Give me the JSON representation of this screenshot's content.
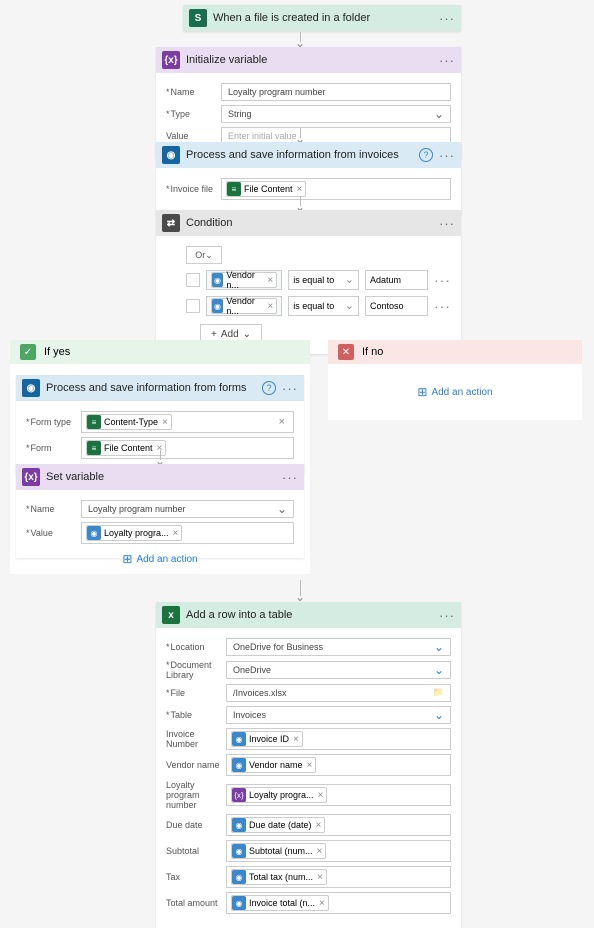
{
  "trigger": {
    "title": "When a file is created in a folder"
  },
  "init_var": {
    "title": "Initialize variable",
    "name_lbl": "Name",
    "name_val": "Loyalty program number",
    "type_lbl": "Type",
    "type_val": "String",
    "value_lbl": "Value",
    "value_ph": "Enter initial value"
  },
  "ai_invoices": {
    "title": "Process and save information from invoices",
    "file_lbl": "Invoice file",
    "file_token": "File Content"
  },
  "condition": {
    "title": "Condition",
    "group_op": "Or",
    "rows": [
      {
        "field": "Vendor n...",
        "op": "is equal to",
        "val": "Adatum"
      },
      {
        "field": "Vendor n...",
        "op": "is equal to",
        "val": "Contoso"
      }
    ],
    "add": "Add"
  },
  "branches": {
    "yes": "If yes",
    "no": "If no",
    "add_action": "Add an action"
  },
  "ai_forms": {
    "title": "Process and save information from  forms",
    "type_lbl": "Form type",
    "type_token": "Content-Type",
    "form_lbl": "Form",
    "form_token": "File Content"
  },
  "set_var": {
    "title": "Set variable",
    "name_lbl": "Name",
    "name_val": "Loyalty program number",
    "value_lbl": "Value",
    "value_token": "Loyalty progra..."
  },
  "excel": {
    "title": "Add a row into a table",
    "location_lbl": "Location",
    "location_val": "OneDrive for Business",
    "doclib_lbl": "Document Library",
    "doclib_val": "OneDrive",
    "file_lbl": "File",
    "file_val": "/Invoices.xlsx",
    "table_lbl": "Table",
    "table_val": "Invoices",
    "rows": [
      {
        "lbl": "Invoice Number",
        "token": "Invoice ID",
        "chip": "blue"
      },
      {
        "lbl": "Vendor name",
        "token": "Vendor name",
        "chip": "blue"
      },
      {
        "lbl": "Loyalty program number",
        "token": "Loyalty progra...",
        "chip": "purple"
      },
      {
        "lbl": "Due date",
        "token": "Due date (date)",
        "chip": "blue"
      },
      {
        "lbl": "Subtotal",
        "token": "Subtotal (num...",
        "chip": "blue"
      },
      {
        "lbl": "Tax",
        "token": "Total tax (num...",
        "chip": "blue"
      },
      {
        "lbl": "Total amount",
        "token": "Invoice total (n...",
        "chip": "blue"
      }
    ]
  }
}
